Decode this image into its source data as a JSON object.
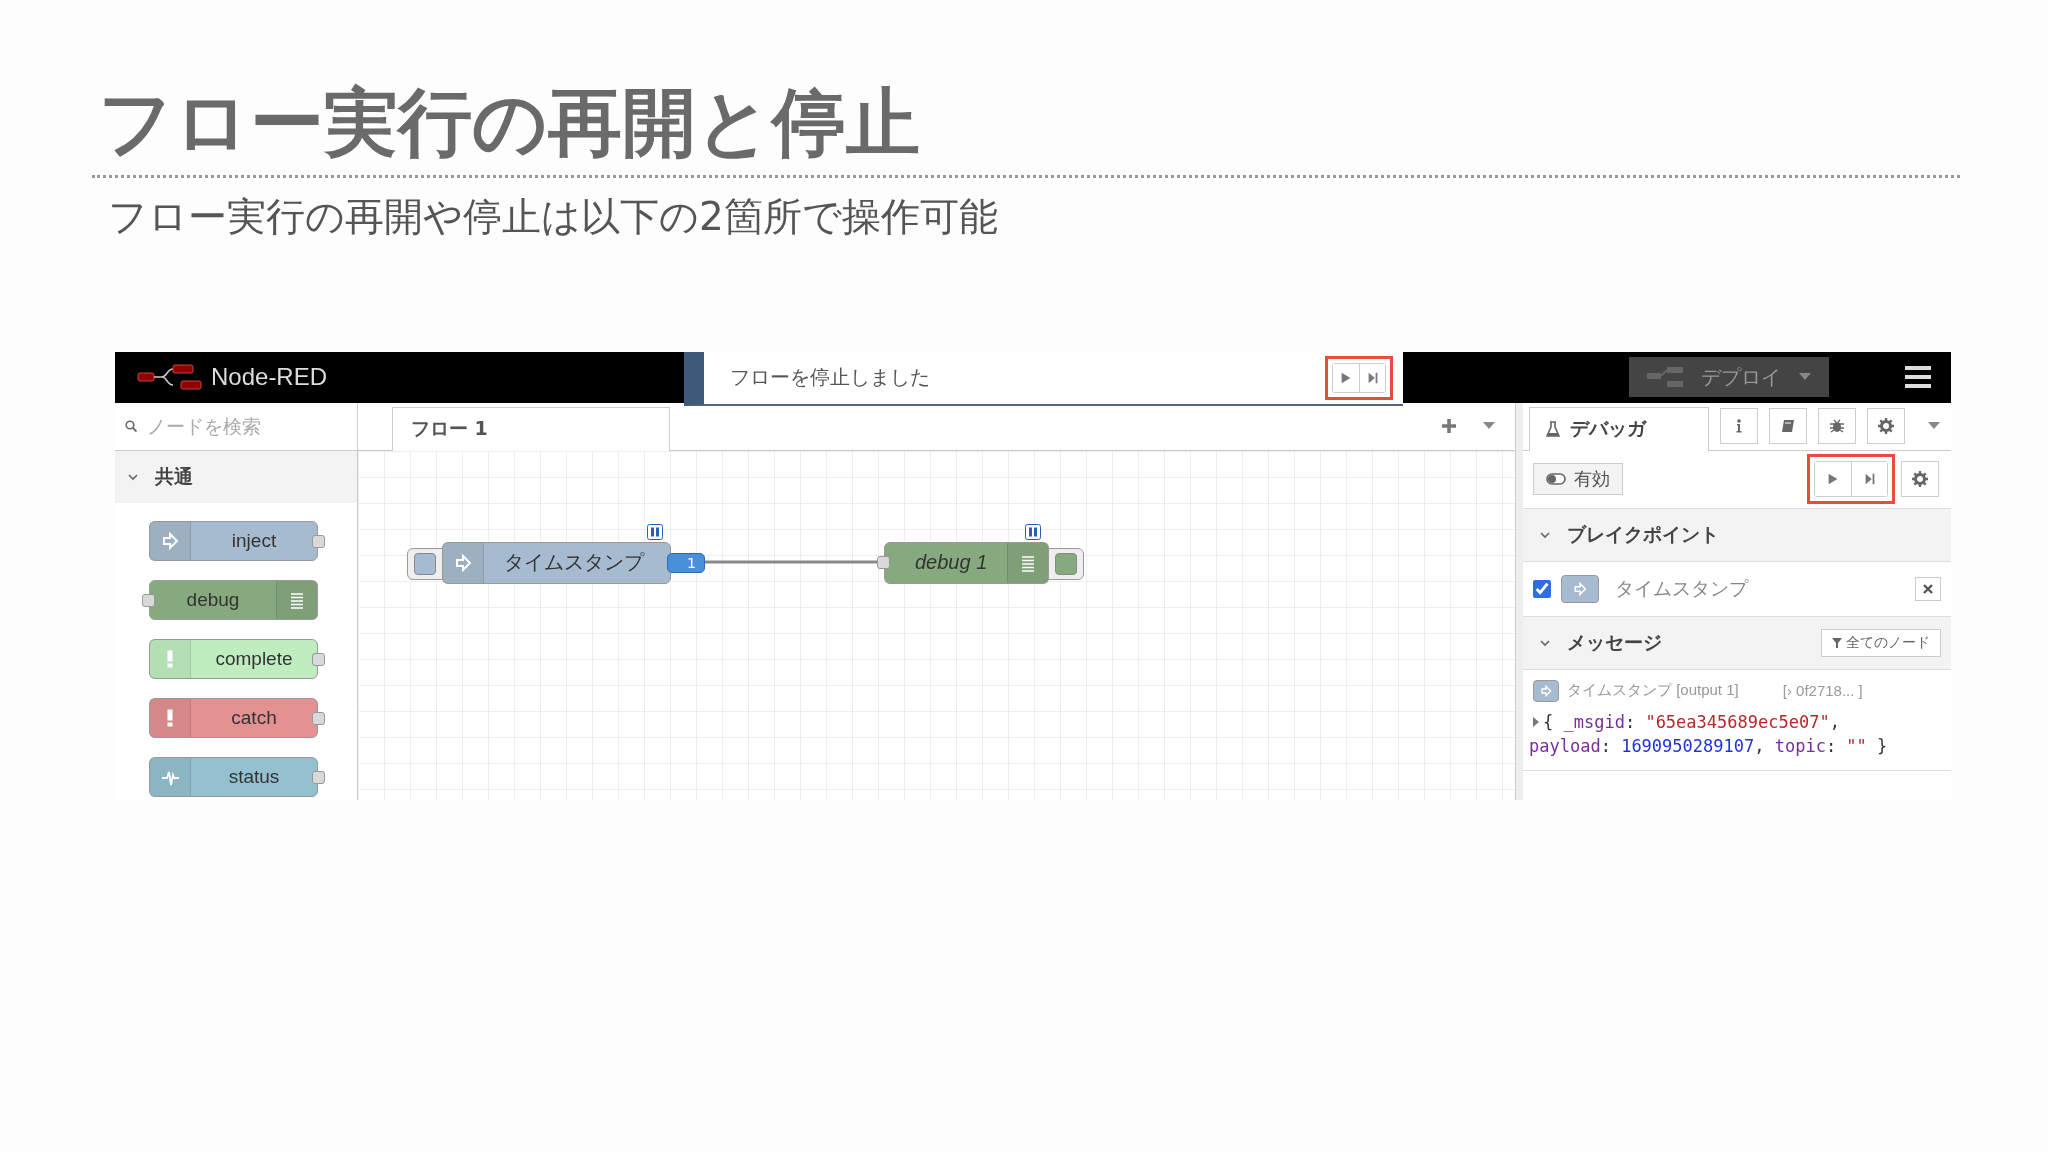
{
  "slide": {
    "title": "フロー実行の再開と停止",
    "subtitle": "フロー実行の再開や停止は以下の2箇所で操作可能"
  },
  "header": {
    "logo_text": "Node-RED",
    "deploy_label": "デプロイ"
  },
  "notification": {
    "text": "フローを停止しました",
    "highlighted": true
  },
  "palette": {
    "search": {
      "placeholder": "ノードを検索"
    },
    "category": {
      "label": "共通",
      "expanded": true
    },
    "nodes": [
      {
        "label": "inject",
        "kind": "inject",
        "color": "#a6bbcf"
      },
      {
        "label": "debug",
        "kind": "debug",
        "color": "#87a980"
      },
      {
        "label": "complete",
        "kind": "complete",
        "color": "#c0edc0"
      },
      {
        "label": "catch",
        "kind": "catch",
        "color": "#e49191"
      },
      {
        "label": "status",
        "kind": "status",
        "color": "#94c1d0"
      }
    ]
  },
  "workspace": {
    "tabs": [
      {
        "label": "フロー 1",
        "selected": true
      }
    ],
    "nodes": [
      {
        "label": "タイムスタンプ",
        "kind": "inject",
        "paused": true,
        "count": "1"
      },
      {
        "label": "debug 1",
        "kind": "debug",
        "paused": true
      }
    ]
  },
  "sidebar": {
    "tab": {
      "label": "デバッガ",
      "selected": true
    },
    "toggle_label": "有効",
    "highlighted": true,
    "breakpoints": {
      "title": "ブレイクポイント",
      "expanded": true,
      "items": [
        {
          "label": "タイムスタンプ",
          "checked": true
        }
      ]
    },
    "messages": {
      "title": "メッセージ",
      "expanded": true,
      "filter_label": "全てのノード",
      "items": [
        {
          "source": "タイムスタンプ [output 1]",
          "id": "[› 0f2718... ]",
          "lines": [
            [
              {
                "kind": "punct",
                "text": "{ "
              },
              {
                "kind": "key",
                "text": "_msgid"
              },
              {
                "kind": "punct",
                "text": ": "
              },
              {
                "kind": "string",
                "text": "\"65ea345689ec5e07\""
              },
              {
                "kind": "punct",
                "text": ","
              }
            ],
            [
              {
                "kind": "key",
                "text": "payload"
              },
              {
                "kind": "punct",
                "text": ": "
              },
              {
                "kind": "number",
                "text": "1690950289107"
              },
              {
                "kind": "punct",
                "text": ", "
              },
              {
                "kind": "key",
                "text": "topic"
              },
              {
                "kind": "punct",
                "text": ": "
              },
              {
                "kind": "string",
                "text": "\"\""
              },
              {
                "kind": "punct",
                "text": " }"
              }
            ]
          ]
        }
      ]
    }
  }
}
